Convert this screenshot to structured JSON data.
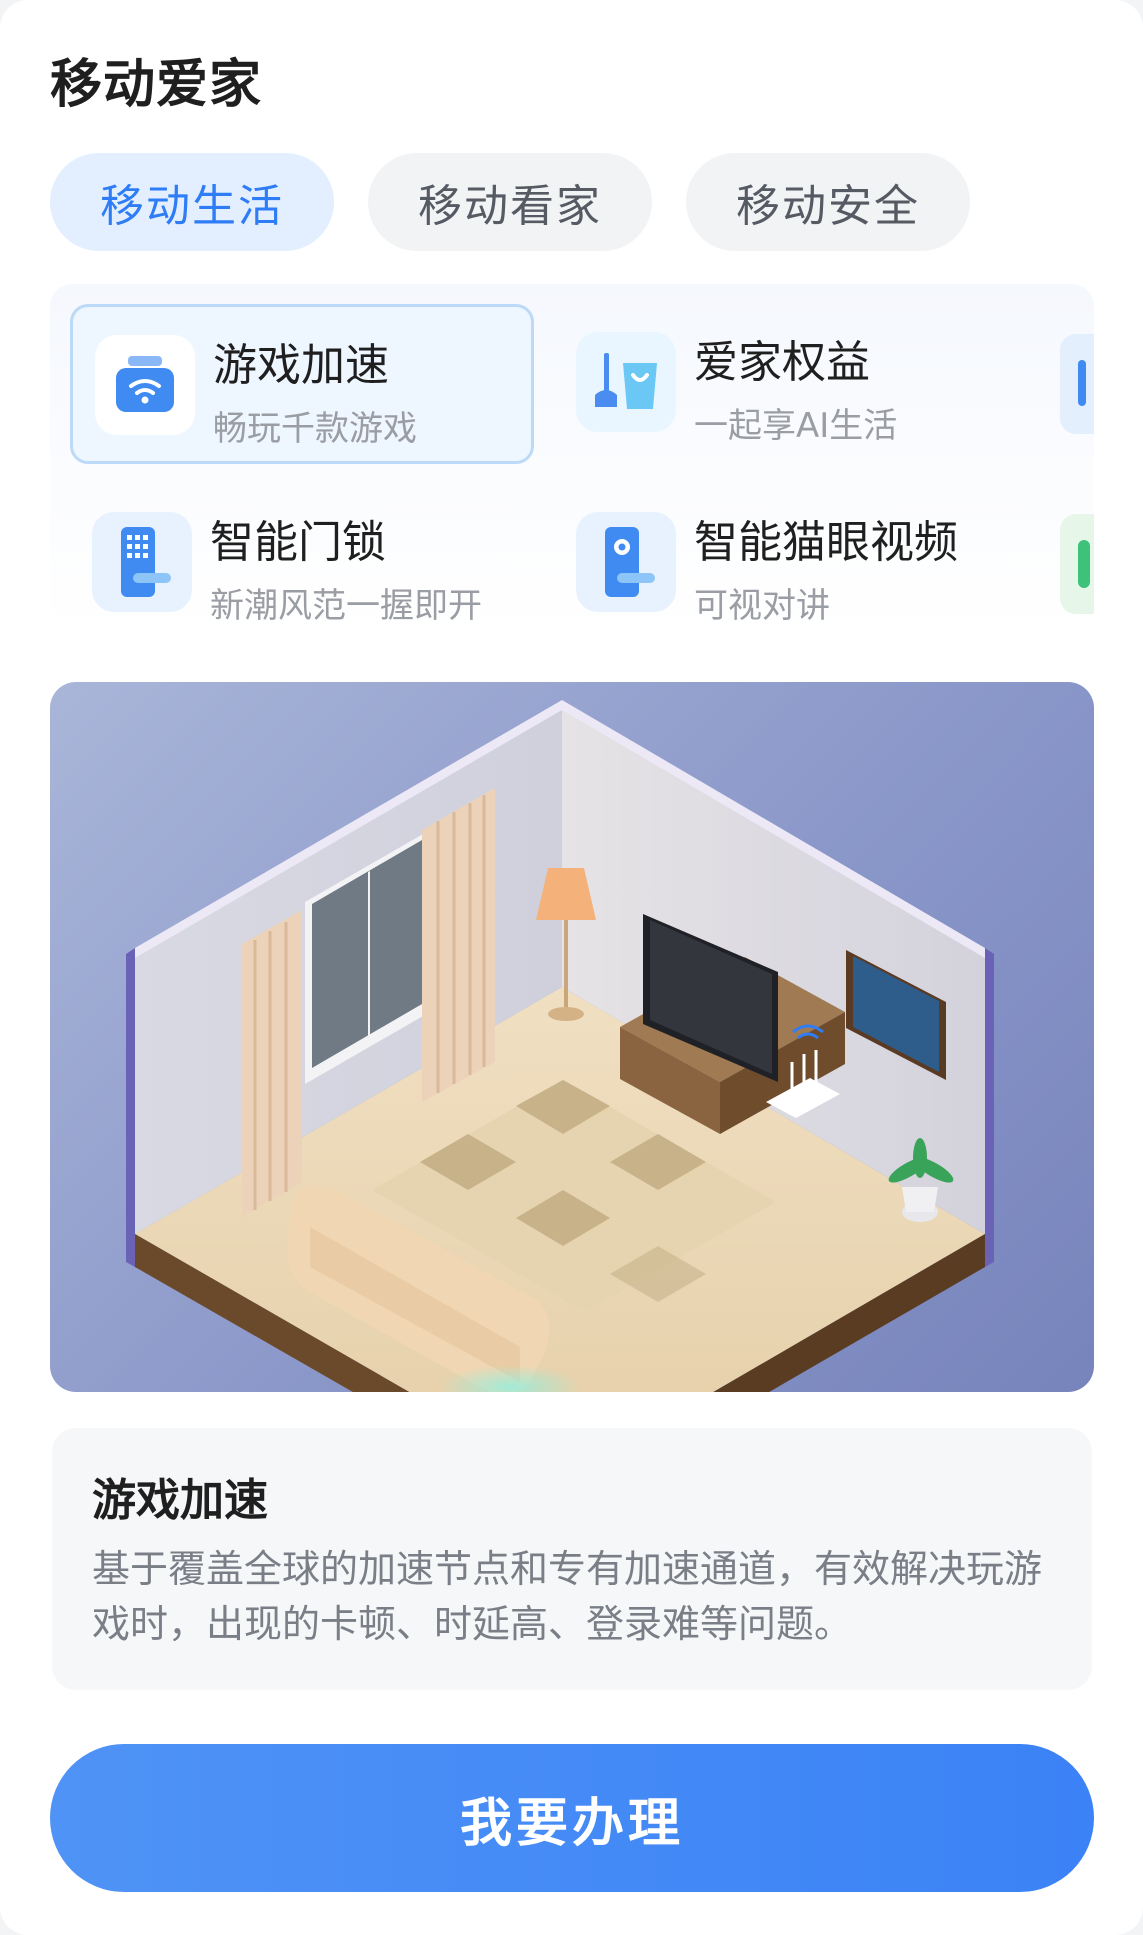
{
  "page_title": "移动爱家",
  "tabs": [
    {
      "label": "移动生活",
      "active": true
    },
    {
      "label": "移动看家",
      "active": false
    },
    {
      "label": "移动安全",
      "active": false
    }
  ],
  "features": [
    {
      "name": "游戏加速",
      "sub": "畅玩千款游戏",
      "icon": "router-wifi-icon",
      "selected": true
    },
    {
      "name": "爱家权益",
      "sub": "一起享AI生活",
      "icon": "broom-bag-icon",
      "selected": false
    },
    {
      "name": "智能门锁",
      "sub": "新潮风范一握即开",
      "icon": "smart-lock-icon",
      "selected": false
    },
    {
      "name": "智能猫眼视频",
      "sub": "可视对讲",
      "icon": "door-camera-icon",
      "selected": false
    }
  ],
  "illustration": {
    "icon": "living-room-illustration"
  },
  "detail": {
    "heading": "游戏加速",
    "text": "基于覆盖全球的加速节点和专有加速通道，有效解决玩游戏时，出现的卡顿、时延高、登录难等问题。"
  },
  "cta_label": "我要办理",
  "colors": {
    "accent": "#2f7df6",
    "tab_active_bg": "#e3efff",
    "cta": "#3b82f6"
  }
}
